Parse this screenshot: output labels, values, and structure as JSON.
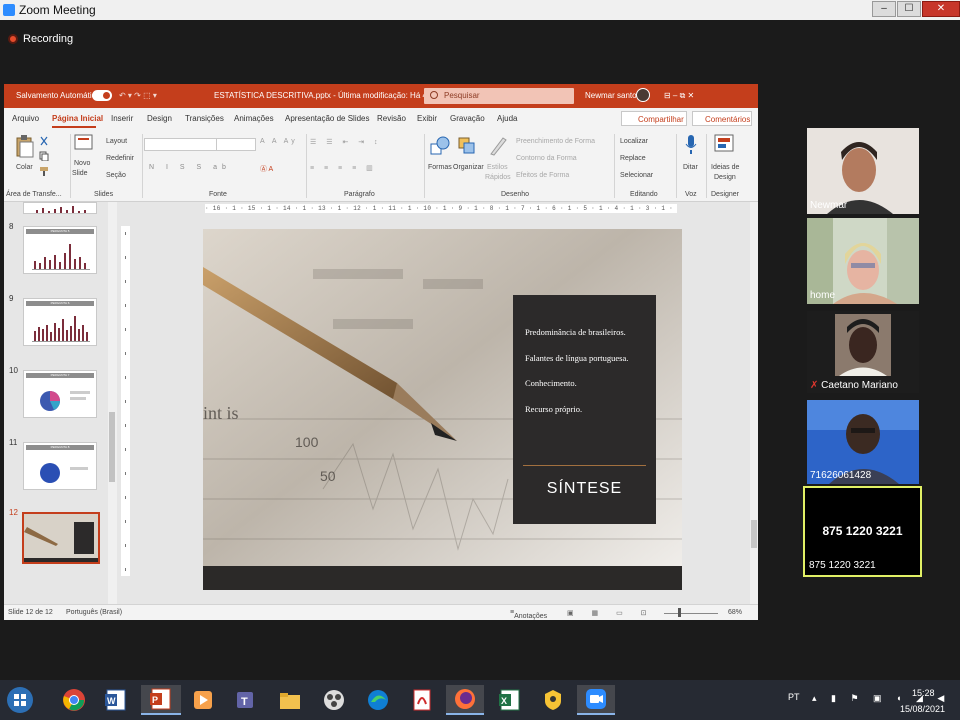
{
  "zoom": {
    "title": "Zoom Meeting",
    "recording_label": "Recording",
    "window_controls": [
      "–",
      "☐",
      "✕"
    ]
  },
  "ppt": {
    "autosave_label": "Salvamento Automático",
    "quick_access": "↶ ▾  ↷  ⬚  ▾",
    "doc_title": "ESTATÍSTICA DESCRITIVA.pptx  -  Última modificação: Há 4 h  ▾",
    "search_placeholder": "Pesquisar",
    "user_name": "Newmar santos",
    "title_controls": "⊟  –  ⧉  ✕",
    "tabs": [
      "Arquivo",
      "Página Inicial",
      "Inserir",
      "Design",
      "Transições",
      "Animações",
      "Apresentação de Slides",
      "Revisão",
      "Exibir",
      "Gravação",
      "Ajuda"
    ],
    "share_label": "Compartilhar",
    "comments_label": "Comentários",
    "ribbon": {
      "paste": "Colar",
      "new_slide_1": "Novo",
      "new_slide_2": "Slide",
      "layout": "Layout",
      "reset": "Redefinir",
      "section": "Seção",
      "styles": "Estilos",
      "quick": "Rápidos",
      "shapes": "Formas",
      "arrange": "Organizar",
      "shape_fill": "Preenchimento de Forma",
      "shape_outline": "Contorno da Forma",
      "shape_effects": "Efeitos de Forma",
      "find": "Localizar",
      "replace": "Replace",
      "select": "Selecionar",
      "dictate": "Ditar",
      "ideas_1": "Ideias de",
      "ideas_2": "Design",
      "groups": [
        "Área de Transfe...",
        "Slides",
        "Fonte",
        "Parágrafo",
        "Desenho",
        "Editando",
        "Voz",
        "Designer"
      ]
    },
    "thumbnails": [
      {
        "num": "8",
        "header": "PERGUNTA 5"
      },
      {
        "num": "9",
        "header": "PERGUNTA 6"
      },
      {
        "num": "10",
        "header": "PERGUNTA 7"
      },
      {
        "num": "11",
        "header": "PERGUNTA 8"
      },
      {
        "num": "12",
        "header": ""
      }
    ],
    "ruler": "· 16 · 1 · 15 · 1 · 14 · 1 · 13 · 1 · 12 · 1 · 11 · 1 · 10 · 1 · 9 · 1 · 8 · 1 · 7 · 1 · 6 · 1 · 5 · 1 · 4 · 1 · 3 · 1 · 2 · 1 · 1 · 1 · 0 · 1 · 1 · 1 · 2 · 1 · 3 · 1 · 4 · 1 · 5 · 1 · 6 · 1 · 7 · 1 · 8 · 1 · 9 · 1 · 10 · 1 · 11 · 1 · 12 · 1 · 13 · 1 · 14 · 1 · 15 · 1 · 16 ·",
    "slide": {
      "bullets": [
        "Predominância de brasileiros.",
        "Falantes de língua portuguesa.",
        "Conhecimento.",
        "Recurso próprio."
      ],
      "title": "SÍNTESE",
      "photo_text_1": "int is",
      "photo_text_2": "100",
      "photo_text_3": "50"
    },
    "status": {
      "slide_count": "Slide 12 de 12",
      "language": "Português (Brasil)",
      "notes": "Anotações",
      "zoom": "68%"
    }
  },
  "participants": [
    {
      "name": "Newmar"
    },
    {
      "name": "home"
    },
    {
      "name": "Caetano Mariano"
    },
    {
      "name": "71626061428"
    }
  ],
  "active_speaker": {
    "number": "875 1220 3221",
    "name": "875 1220 3221"
  },
  "taskbar": {
    "apps": [
      "start-button",
      "chrome-icon",
      "word-icon",
      "powerpoint-icon",
      "media-icon",
      "teams-icon",
      "explorer-icon",
      "video-icon",
      "edge-icon",
      "acrobat-icon",
      "firefox-icon",
      "excel-icon",
      "vpn-icon",
      "zoom-icon"
    ],
    "lang": "PT",
    "time": "15:28",
    "date": "15/08/2021"
  },
  "colors": {
    "ppt_accent": "#c43e1c",
    "zoom_active_border": "#e1f066",
    "recording": "#e34b2b"
  }
}
